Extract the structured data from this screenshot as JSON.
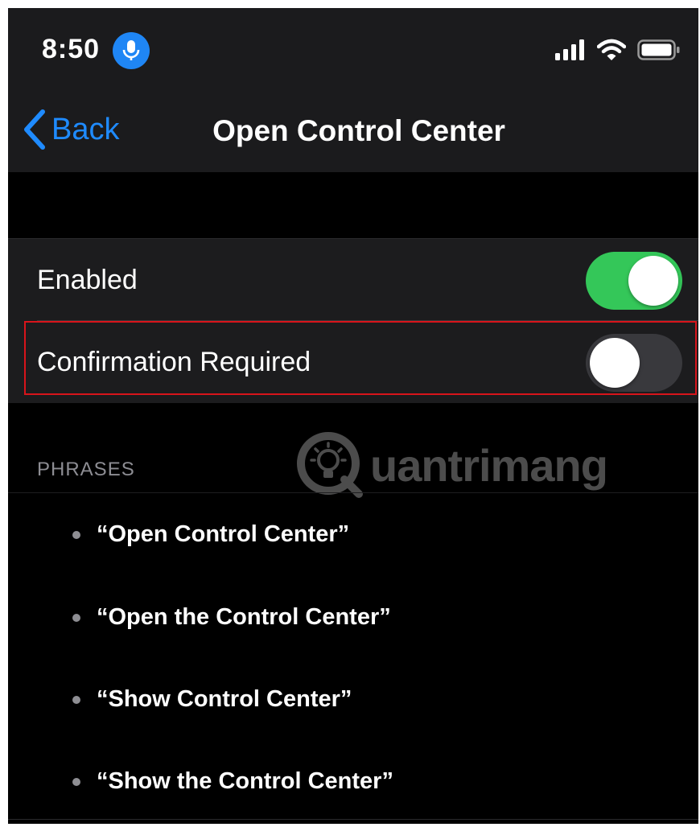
{
  "status_bar": {
    "time": "8:50",
    "mic_icon": "microphone-icon",
    "icons": [
      "cellular-signal-icon",
      "wifi-icon",
      "battery-icon"
    ]
  },
  "nav": {
    "back_label": "Back",
    "title": "Open Control Center"
  },
  "settings": {
    "enabled": {
      "label": "Enabled",
      "on": true
    },
    "confirmation": {
      "label": "Confirmation Required",
      "on": false
    }
  },
  "phrases": {
    "header": "PHRASES",
    "items": [
      "“Open Control Center”",
      "“Open the Control Center”",
      "“Show Control Center”",
      "“Show the Control Center”"
    ]
  },
  "watermark": {
    "text": "uantrimang"
  },
  "colors": {
    "accent_blue": "#1f8bff",
    "toggle_on": "#34c759",
    "highlight_red": "#d8141b"
  }
}
